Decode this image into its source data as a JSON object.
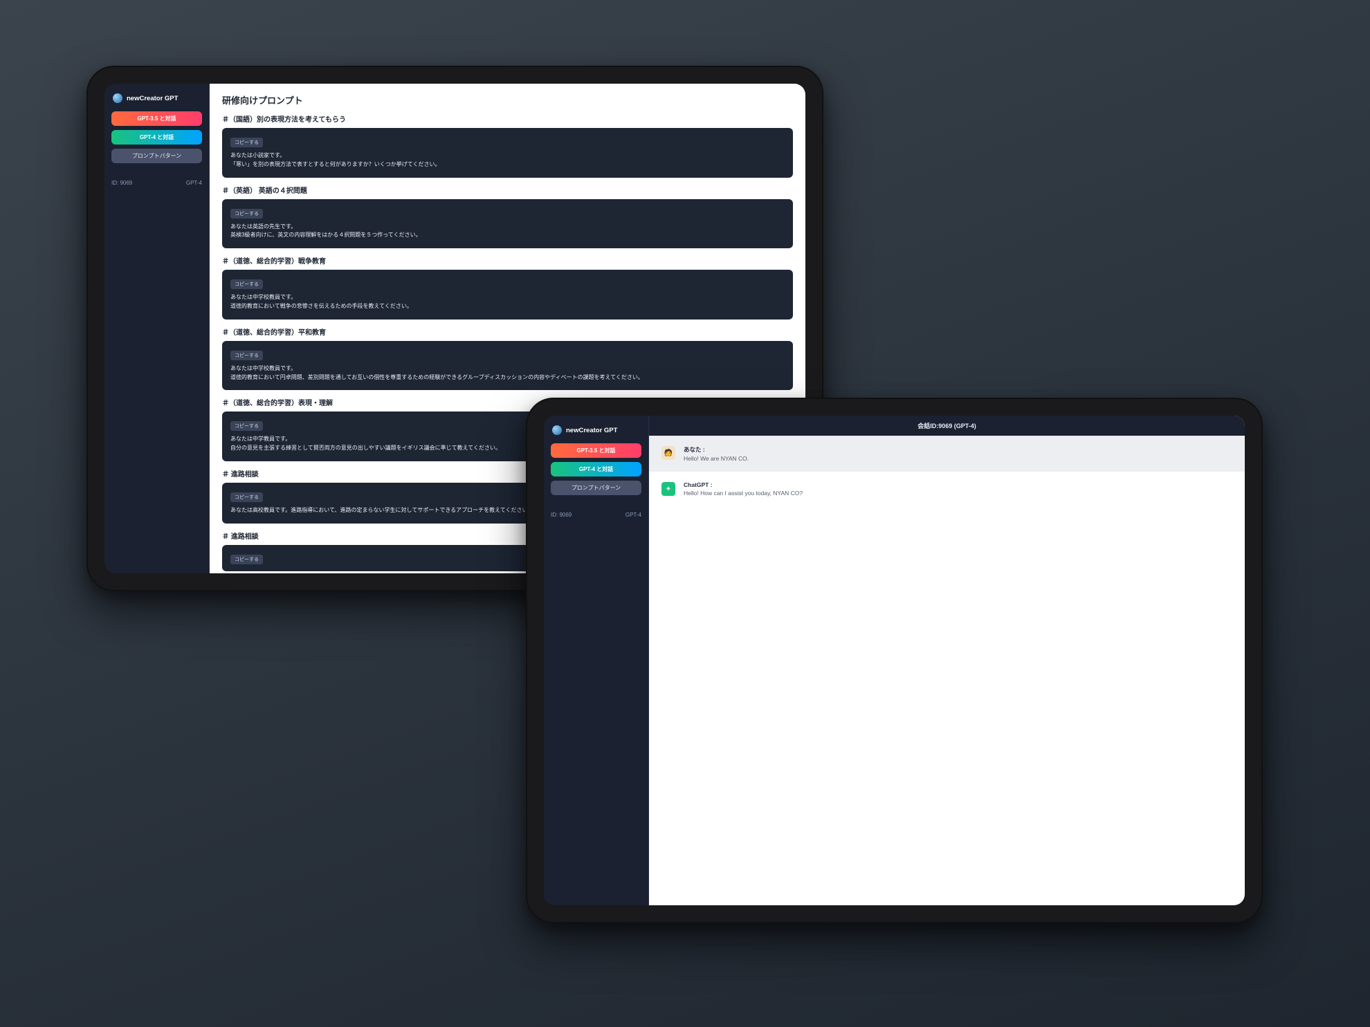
{
  "brand": "newCreator GPT",
  "sidebar": {
    "btn35": "GPT-3.5 と対話",
    "btn4": "GPT-4 と対話",
    "btnPrompt": "プロンプトパターン",
    "idLabel": "ID: 9069",
    "modelLabel": "GPT-4"
  },
  "prompts": {
    "pageTitle": "研修向けプロンプト",
    "copyLabel": "コピーする",
    "sections": [
      {
        "title": "＃（国語）別の表現方法を考えてもらう",
        "lines": [
          "あなたは小説家です。",
          "「寒い」を別の表現方法で表すとすると何がありますか？いくつか挙げてください。"
        ]
      },
      {
        "title": "＃（英語） 英語の４択問題",
        "lines": [
          "あなたは英語の先生です。",
          "英検3級者向けに、英文の内容理解をはかる４択問題を５つ作ってください。"
        ]
      },
      {
        "title": "＃（道徳、総合的学習）戦争教育",
        "lines": [
          "あなたは中学校教員です。",
          "道徳的教育において戦争の悲惨さを伝えるための手段を教えてください。"
        ]
      },
      {
        "title": "＃（道徳、総合的学習）平和教育",
        "lines": [
          "あなたは中学校教員です。",
          "道徳的教育において円卓問題、差別問題を通してお互いの個性を尊重するための経験ができるグループディスカッションの内容やディベートの課題を考えてください。"
        ]
      },
      {
        "title": "＃（道徳、総合的学習）表現・理解",
        "lines": [
          "あなたは中学教員です。",
          "自分の意見を主張する練習として賛否両方の意見の出しやすい議題をイギリス議会に準じて教えてください。"
        ]
      },
      {
        "title": "＃ 進路相談",
        "lines": [
          "あなたは高校教員です。進路指導において、進路の定まらない学生に対してサポートできるアプローチを教えてください。"
        ]
      },
      {
        "title": "＃ 進路相談",
        "lines": []
      }
    ]
  },
  "chat": {
    "headerTitle": "会話ID:9069 (GPT-4)",
    "userName": "あなた :",
    "userText": "Hello! We are NYAN CO.",
    "botName": "ChatGPT :",
    "botText": "Hello! How can I assist you today, NYAN CO?"
  }
}
